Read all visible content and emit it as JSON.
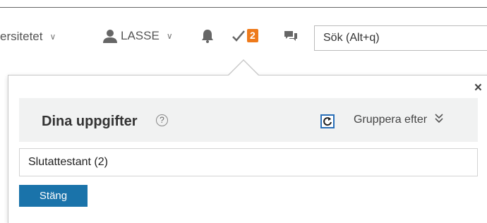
{
  "topbar": {
    "org_label": "ersitetet",
    "user_label": "LASSE",
    "tasks_badge": "2",
    "search_placeholder": "Sök (Alt+q)"
  },
  "tasks_panel": {
    "title": "Dina uppgifter",
    "help_glyph": "?",
    "group_label": "Gruppera efter",
    "group_chevron": "»",
    "close_glyph": "×",
    "rows": [
      {
        "label": "Slutattestant (2)"
      }
    ],
    "close_button_label": "Stäng"
  },
  "colors": {
    "badge": "#ee7a1b",
    "primary_button": "#1a73aa",
    "refresh_border": "#2a6fb8",
    "panel_bg": "#f1f2f2"
  }
}
